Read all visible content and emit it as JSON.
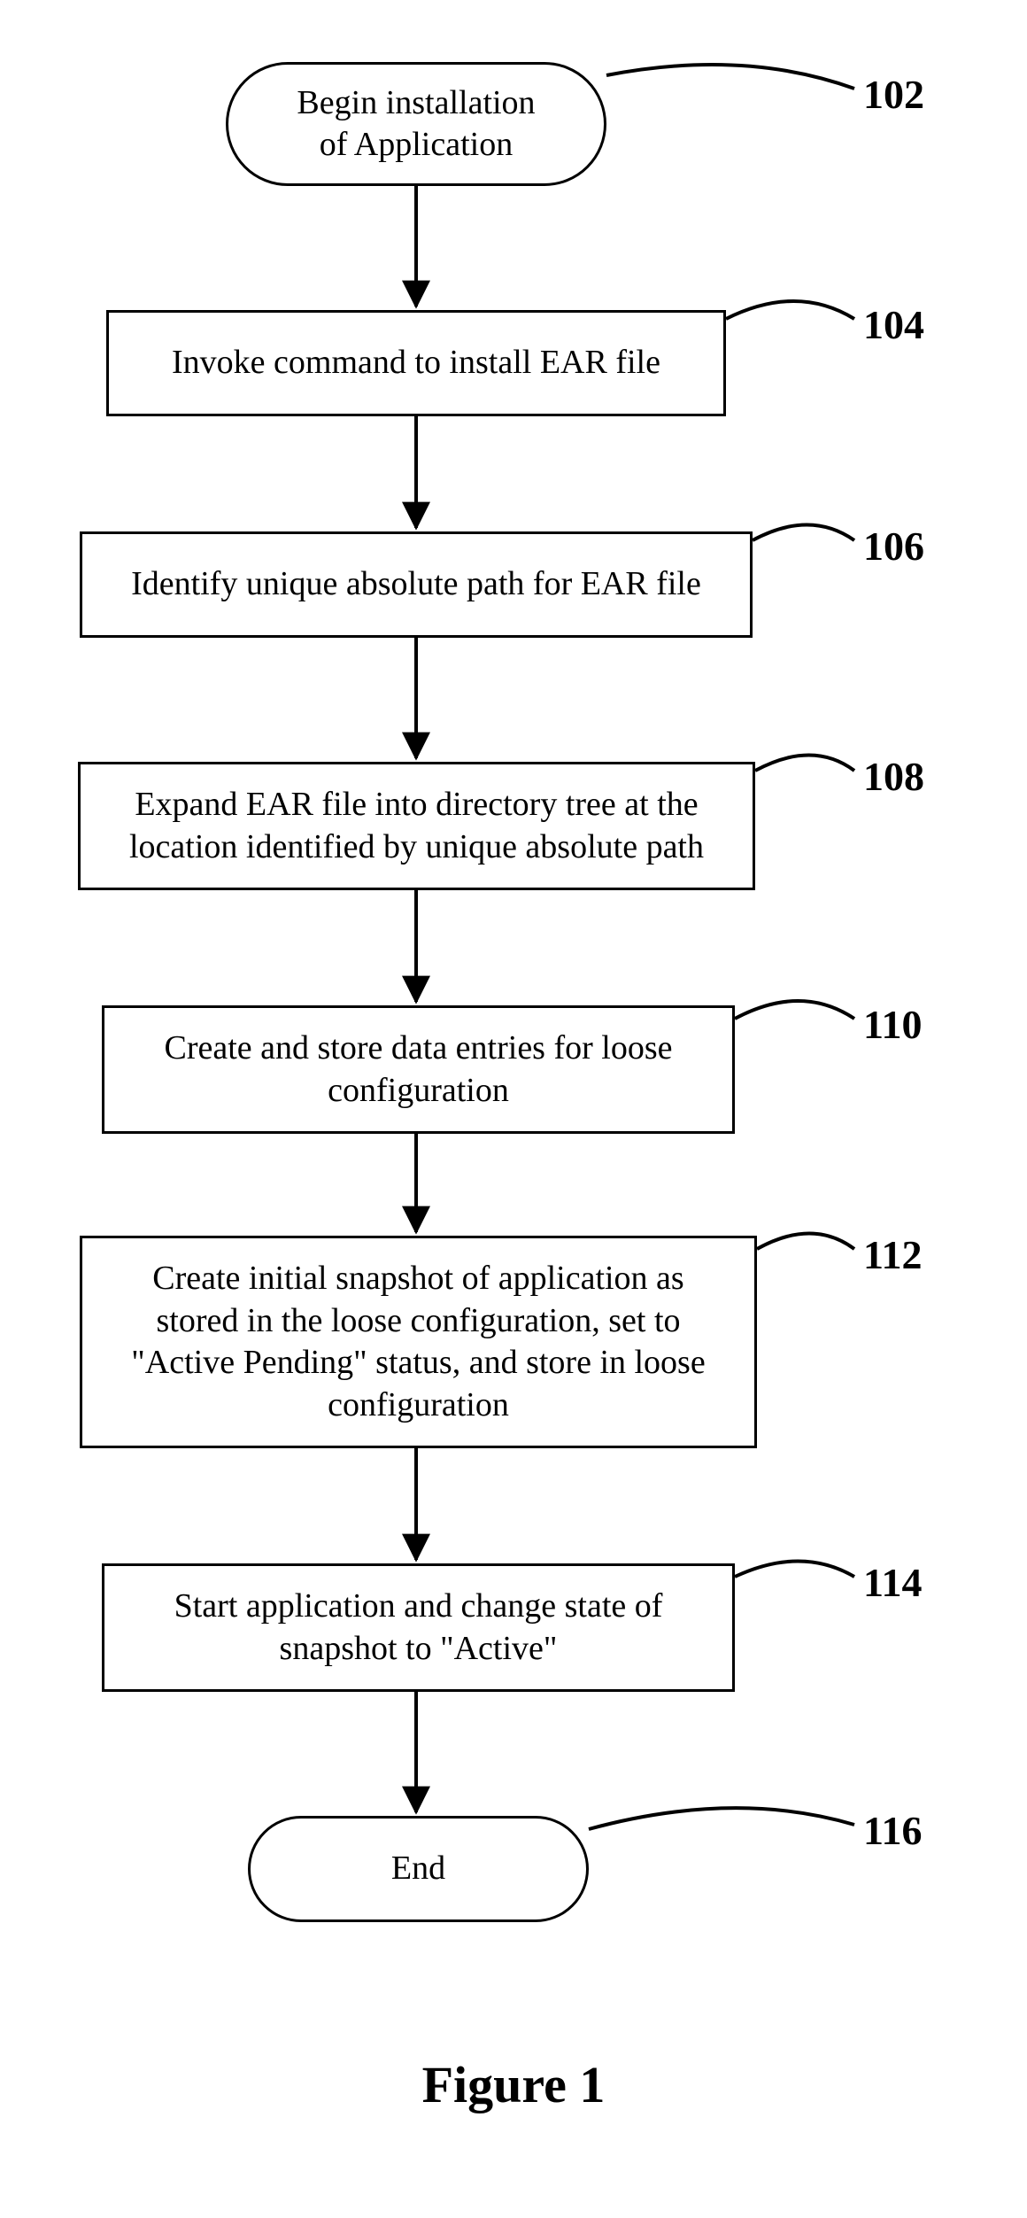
{
  "chart_data": {
    "type": "flowchart",
    "title": "Figure 1",
    "nodes": [
      {
        "id": "102",
        "shape": "terminal",
        "label": "Begin installation of Application"
      },
      {
        "id": "104",
        "shape": "process",
        "label": "Invoke command to install EAR file"
      },
      {
        "id": "106",
        "shape": "process",
        "label": "Identify unique absolute path for EAR file"
      },
      {
        "id": "108",
        "shape": "process",
        "label": "Expand EAR file into directory tree at the location identified by unique absolute path"
      },
      {
        "id": "110",
        "shape": "process",
        "label": "Create and store data entries for loose configuration"
      },
      {
        "id": "112",
        "shape": "process",
        "label": "Create initial snapshot of application as stored in the loose configuration, set to \"Active Pending\" status, and store in loose configuration"
      },
      {
        "id": "114",
        "shape": "process",
        "label": "Start application and change state of snapshot to \"Active\""
      },
      {
        "id": "116",
        "shape": "terminal",
        "label": "End"
      }
    ],
    "edges": [
      {
        "from": "102",
        "to": "104"
      },
      {
        "from": "104",
        "to": "106"
      },
      {
        "from": "106",
        "to": "108"
      },
      {
        "from": "108",
        "to": "110"
      },
      {
        "from": "110",
        "to": "112"
      },
      {
        "from": "112",
        "to": "114"
      },
      {
        "from": "114",
        "to": "116"
      }
    ]
  },
  "boxes": {
    "n102": "Begin installation\nof Application",
    "n104": "Invoke command to install EAR file",
    "n106": "Identify unique absolute path for EAR file",
    "n108": "Expand EAR file into directory tree at the\nlocation identified by unique absolute path",
    "n110": "Create and store data entries for loose\nconfiguration",
    "n112": "Create initial snapshot of application as\nstored in the loose configuration, set to\n\"Active Pending\" status, and store in loose\nconfiguration",
    "n114": "Start application and change state of\nsnapshot to \"Active\"",
    "n116": "End"
  },
  "labels": {
    "l102": "102",
    "l104": "104",
    "l106": "106",
    "l108": "108",
    "l110": "110",
    "l112": "112",
    "l114": "114",
    "l116": "116"
  },
  "caption": "Figure 1"
}
